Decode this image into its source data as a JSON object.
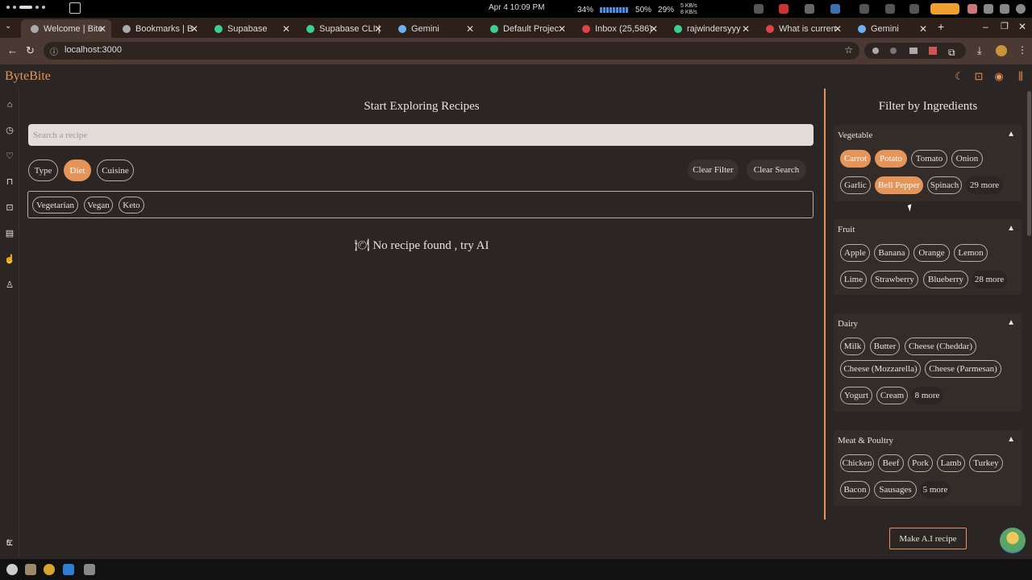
{
  "system": {
    "clock": "Apr 4  10:09 PM",
    "battery": "34%",
    "volume": "50%",
    "cpu": "29%",
    "net_up": "5 KB/s",
    "net_down": "8 KB/s"
  },
  "tabs": [
    {
      "label": "Welcome | Bite"
    },
    {
      "label": "Bookmarks | B"
    },
    {
      "label": "Supabase"
    },
    {
      "label": "Supabase CLI |"
    },
    {
      "label": "Gemini"
    },
    {
      "label": "Default Projec"
    },
    {
      "label": "Inbox (25,586)"
    },
    {
      "label": "rajwindersyyy"
    },
    {
      "label": "What is curren"
    },
    {
      "label": "Gemini"
    }
  ],
  "address": {
    "url": "localhost:3000"
  },
  "app": {
    "logo": "ByteBite"
  },
  "main": {
    "title": "Start Exploring Recipes",
    "search_placeholder": "Search a recipe",
    "filters": [
      "Type",
      "Diet",
      "Cuisine"
    ],
    "active_filter": "Diet",
    "clear_filter": "Clear Filter",
    "clear_search": "Clear Search",
    "diet_options": [
      "Vegetarian",
      "Vegan",
      "Keto"
    ],
    "empty_message": "No recipe found , try AI"
  },
  "filter_panel": {
    "title": "Filter by Ingredients",
    "sections": [
      {
        "name": "Vegetable",
        "items": [
          "Carrot",
          "Potato",
          "Tomato",
          "Onion",
          "Garlic",
          "Bell Pepper",
          "Spinach"
        ],
        "selected": [
          "Carrot",
          "Potato",
          "Bell Pepper"
        ],
        "more": "29 more"
      },
      {
        "name": "Fruit",
        "items": [
          "Apple",
          "Banana",
          "Orange",
          "Lemon",
          "Lime",
          "Strawberry",
          "Blueberry"
        ],
        "selected": [],
        "more": "28 more"
      },
      {
        "name": "Dairy",
        "items": [
          "Milk",
          "Butter",
          "Cheese (Cheddar)",
          "Cheese (Mozzarella)",
          "Cheese (Parmesan)",
          "Yogurt",
          "Cream"
        ],
        "selected": [],
        "more": "8 more"
      },
      {
        "name": "Meat & Poultry",
        "items": [
          "Chicken",
          "Beef",
          "Pork",
          "Lamb",
          "Turkey",
          "Bacon",
          "Sausages"
        ],
        "selected": [],
        "more": "5 more"
      }
    ]
  },
  "ai_button": "Make A.I recipe",
  "colors": {
    "accent": "#e5955a",
    "background": "#2b2523"
  }
}
